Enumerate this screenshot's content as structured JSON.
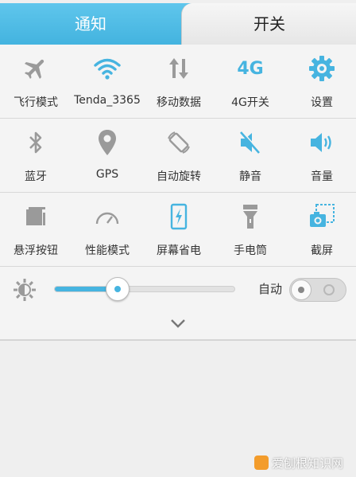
{
  "tabs": {
    "notifications": "通知",
    "toggles": "开关"
  },
  "rows": [
    [
      {
        "label": "飞行模式",
        "icon": "airplane-icon"
      },
      {
        "label": "Tenda_3365",
        "icon": "wifi-icon"
      },
      {
        "label": "移动数据",
        "icon": "mobile-data-icon"
      },
      {
        "label": "4G开关",
        "icon": "4g-icon",
        "icon_text": "4G"
      },
      {
        "label": "设置",
        "icon": "gear-icon"
      }
    ],
    [
      {
        "label": "蓝牙",
        "icon": "bluetooth-icon"
      },
      {
        "label": "GPS",
        "icon": "location-pin-icon"
      },
      {
        "label": "自动旋转",
        "icon": "auto-rotate-icon"
      },
      {
        "label": "静音",
        "icon": "mute-icon"
      },
      {
        "label": "音量",
        "icon": "volume-icon"
      }
    ],
    [
      {
        "label": "悬浮按钮",
        "icon": "floating-button-icon"
      },
      {
        "label": "性能模式",
        "icon": "speedometer-icon"
      },
      {
        "label": "屏幕省电",
        "icon": "battery-saver-icon"
      },
      {
        "label": "手电筒",
        "icon": "flashlight-icon"
      },
      {
        "label": "截屏",
        "icon": "screenshot-icon"
      }
    ]
  ],
  "brightness": {
    "level_fraction": 0.35,
    "auto_label": "自动",
    "auto_enabled": false
  },
  "colors": {
    "accent": "#46b4e0",
    "inactive": "#9a9a9a",
    "tab_active_bg": "#43b3df"
  },
  "watermark": {
    "text": "爱刨根知识网"
  }
}
